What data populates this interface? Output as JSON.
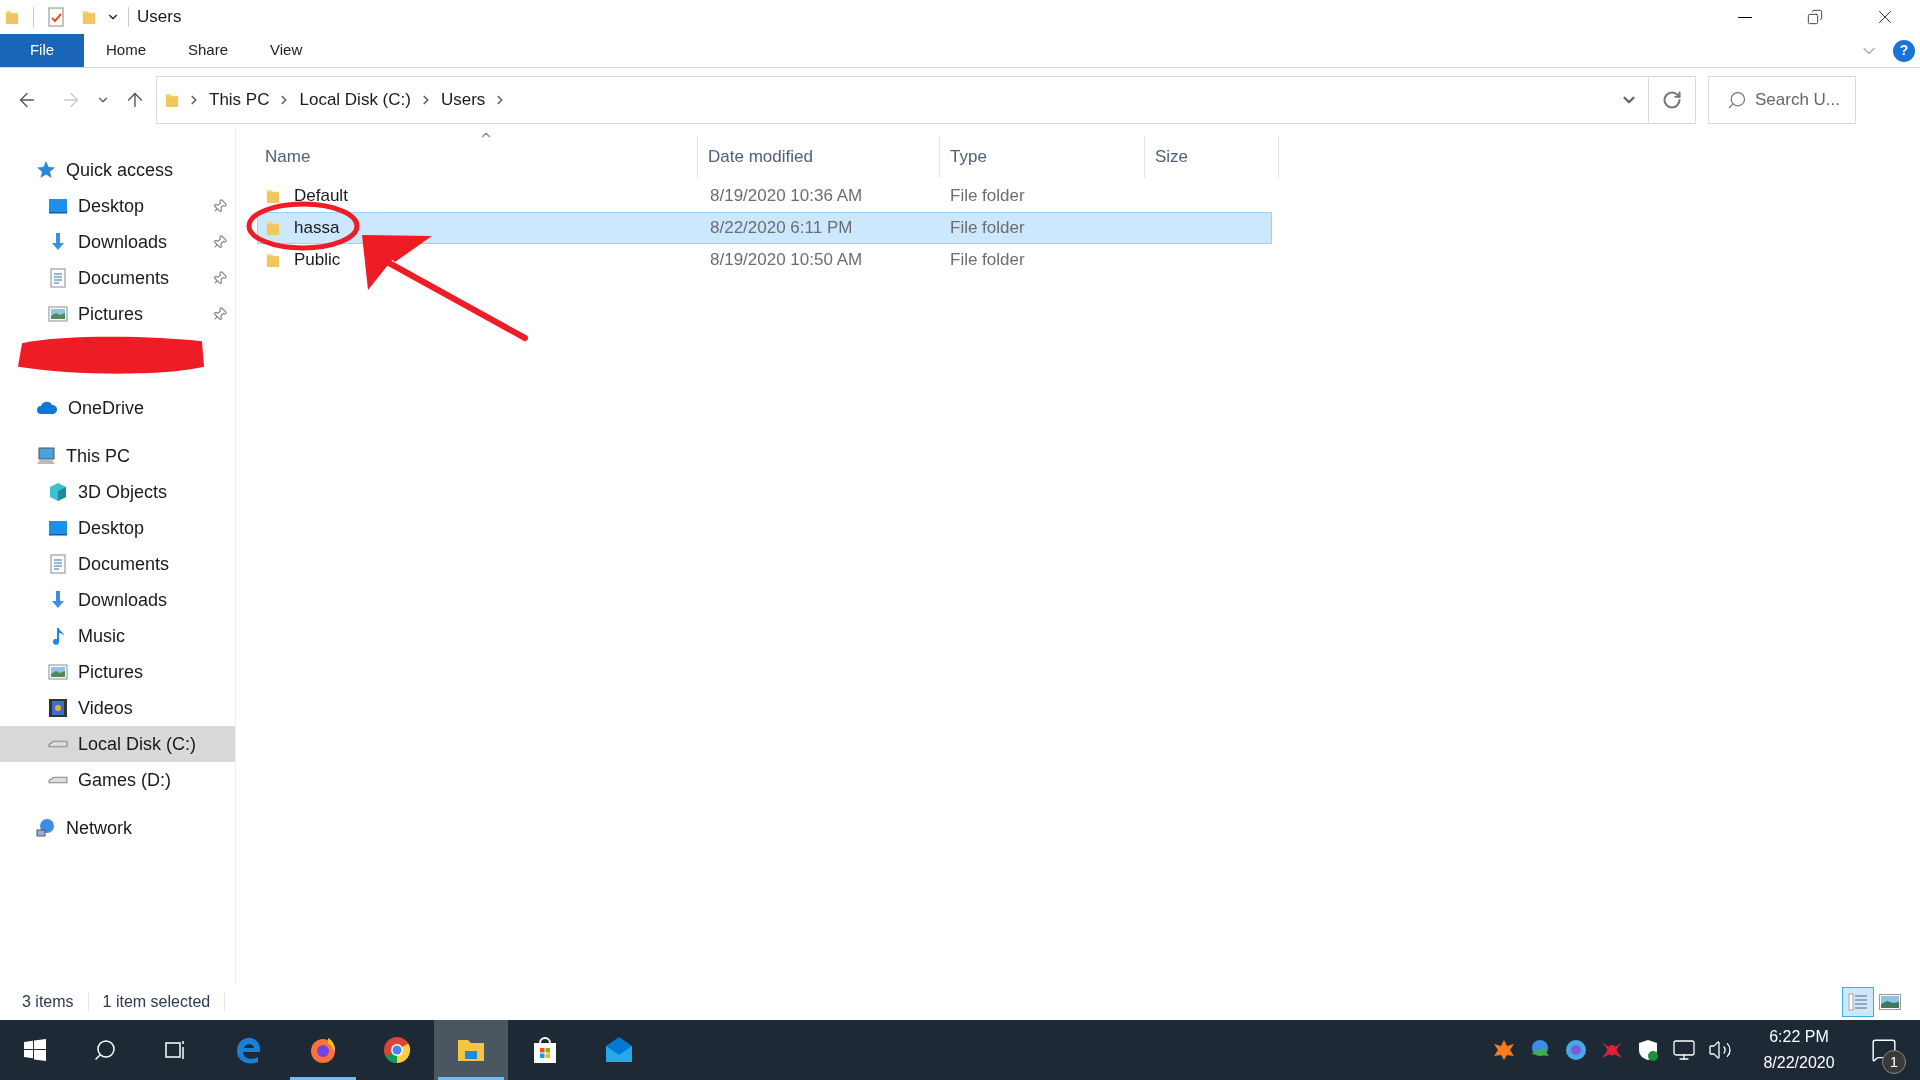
{
  "window": {
    "title": "Users"
  },
  "ribbon_tabs": [
    {
      "label": "File",
      "selected": true
    },
    {
      "label": "Home",
      "selected": false
    },
    {
      "label": "Share",
      "selected": false
    },
    {
      "label": "View",
      "selected": false
    }
  ],
  "help": "?",
  "address": {
    "crumbs": [
      "This PC",
      "Local Disk (C:)",
      "Users"
    ]
  },
  "search": {
    "placeholder": "Search U..."
  },
  "sidebar": {
    "items": [
      {
        "label": "Quick access",
        "kind": "star",
        "selected": false,
        "children": [
          {
            "label": "Desktop",
            "kind": "desktop",
            "pinned": true,
            "selected": false
          },
          {
            "label": "Downloads",
            "kind": "download",
            "pinned": true,
            "selected": false
          },
          {
            "label": "Documents",
            "kind": "document",
            "pinned": true,
            "selected": false
          },
          {
            "label": "Pictures",
            "kind": "picture",
            "pinned": true,
            "selected": false
          },
          {
            "kind": "redacted"
          }
        ]
      },
      {
        "label": "OneDrive",
        "kind": "cloud",
        "selected": false
      },
      {
        "label": "This PC",
        "kind": "pc",
        "selected": false,
        "children": [
          {
            "label": "3D Objects",
            "kind": "cube",
            "selected": false
          },
          {
            "label": "Desktop",
            "kind": "desktop",
            "selected": false
          },
          {
            "label": "Documents",
            "kind": "document",
            "selected": false
          },
          {
            "label": "Downloads",
            "kind": "download",
            "selected": false
          },
          {
            "label": "Music",
            "kind": "music",
            "selected": false
          },
          {
            "label": "Pictures",
            "kind": "picture",
            "selected": false
          },
          {
            "label": "Videos",
            "kind": "video",
            "selected": false
          },
          {
            "label": "Local Disk (C:)",
            "kind": "drive",
            "selected": true
          },
          {
            "label": "Games (D:)",
            "kind": "drive",
            "selected": false
          }
        ]
      },
      {
        "label": "Network",
        "kind": "network",
        "selected": false
      }
    ]
  },
  "table": {
    "columns": [
      "Name",
      "Date modified",
      "Type",
      "Size"
    ],
    "rows": [
      {
        "name": "Default",
        "date": "8/19/2020 10:36 AM",
        "type": "File folder",
        "selected": false
      },
      {
        "name": "hassa",
        "date": "8/22/2020 6:11 PM",
        "type": "File folder",
        "selected": true
      },
      {
        "name": "Public",
        "date": "8/19/2020 10:50 AM",
        "type": "File folder",
        "selected": false
      }
    ]
  },
  "status_bar": {
    "count": "3 items",
    "selection": "1 item selected",
    "views": [
      {
        "kind": "details",
        "selected": true
      },
      {
        "kind": "thumbnails",
        "selected": false
      }
    ]
  },
  "taskbar": {
    "apps": [
      {
        "kind": "edge",
        "running": false,
        "active": false
      },
      {
        "kind": "firefox",
        "running": true,
        "active": false
      },
      {
        "kind": "chrome",
        "running": false,
        "active": false
      },
      {
        "kind": "explorer",
        "running": true,
        "active": true
      },
      {
        "kind": "store",
        "running": false,
        "active": false
      },
      {
        "kind": "mail",
        "running": false,
        "active": false
      }
    ],
    "time": "6:22 PM",
    "date": "8/22/2020",
    "notifications": "1"
  }
}
